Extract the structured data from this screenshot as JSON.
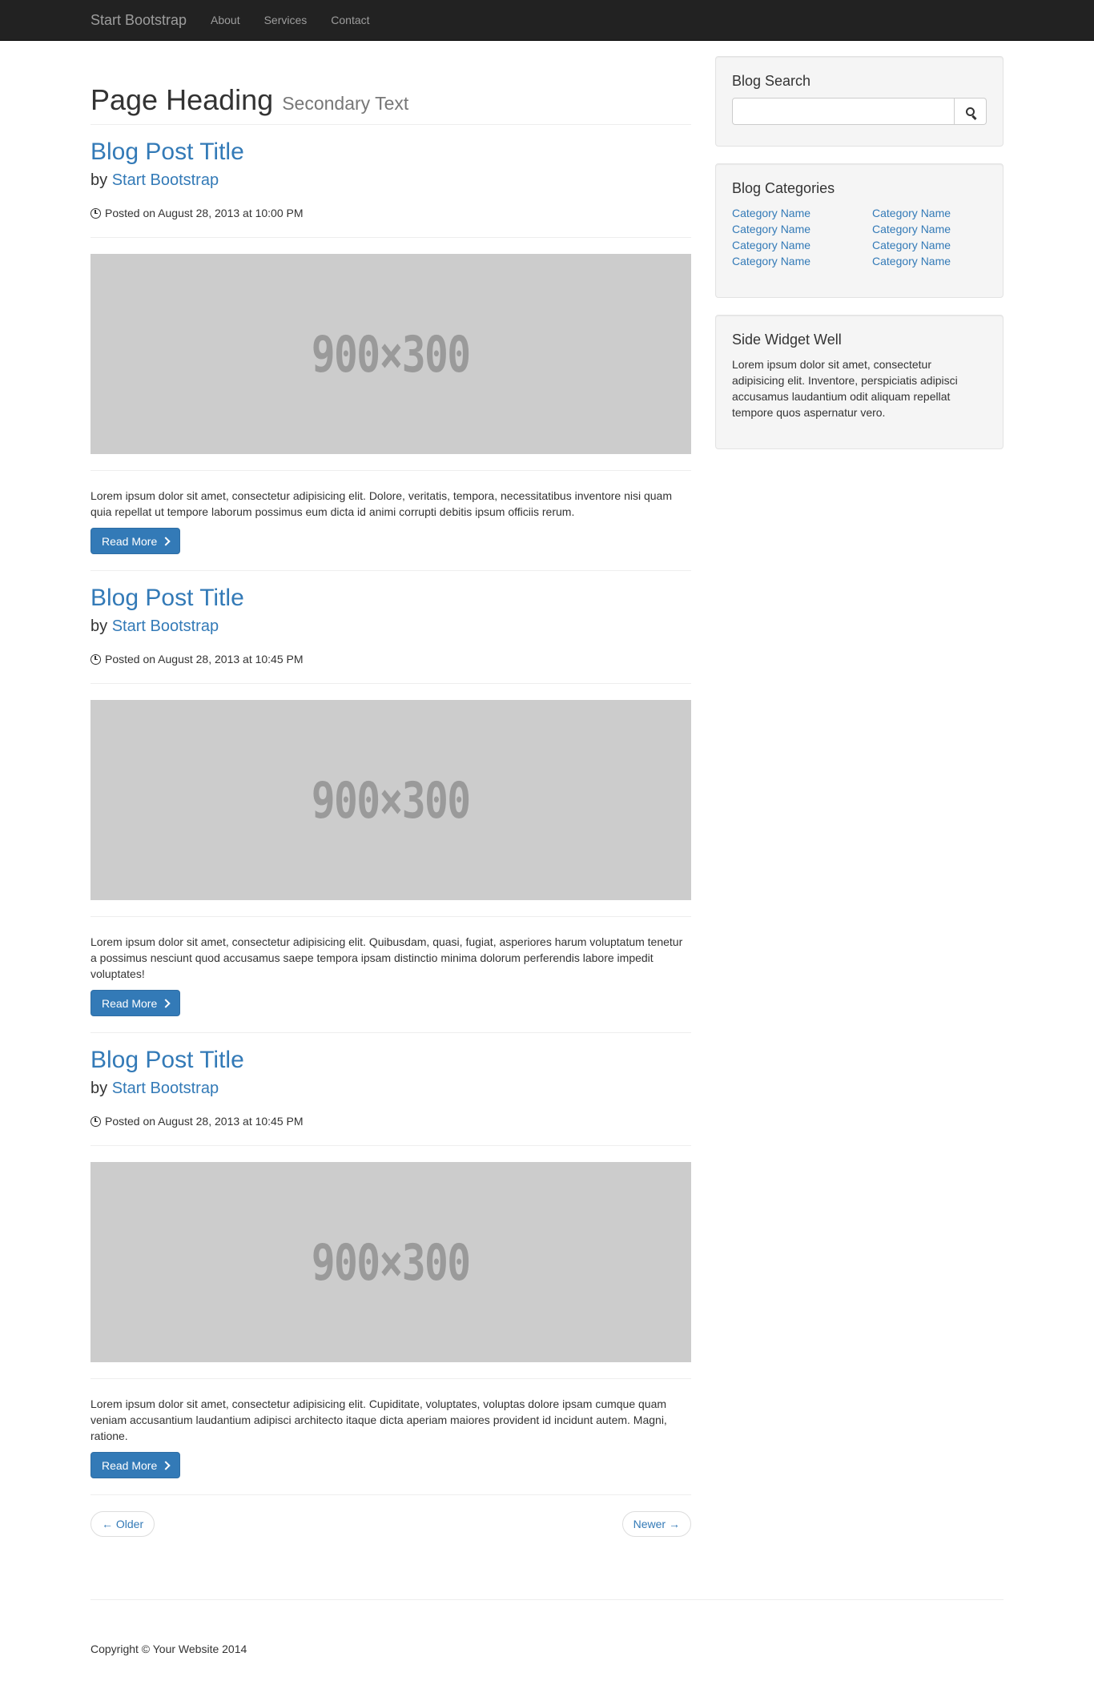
{
  "navbar": {
    "brand": "Start Bootstrap",
    "links": [
      "About",
      "Services",
      "Contact"
    ]
  },
  "header": {
    "heading": "Page Heading",
    "secondary": "Secondary Text"
  },
  "posts": [
    {
      "title": "Blog Post Title",
      "by": "by",
      "author": "Start Bootstrap",
      "date": "Posted on August 28, 2013 at 10:00 PM",
      "image_text": "900×300",
      "text": "Lorem ipsum dolor sit amet, consectetur adipisicing elit. Dolore, veritatis, tempora, necessitatibus inventore nisi quam quia repellat ut tempore laborum possimus eum dicta id animi corrupti debitis ipsum officiis rerum.",
      "read_more": "Read More"
    },
    {
      "title": "Blog Post Title",
      "by": "by",
      "author": "Start Bootstrap",
      "date": "Posted on August 28, 2013 at 10:45 PM",
      "image_text": "900×300",
      "text": "Lorem ipsum dolor sit amet, consectetur adipisicing elit. Quibusdam, quasi, fugiat, asperiores harum voluptatum tenetur a possimus nesciunt quod accusamus saepe tempora ipsam distinctio minima dolorum perferendis labore impedit voluptates!",
      "read_more": "Read More"
    },
    {
      "title": "Blog Post Title",
      "by": "by",
      "author": "Start Bootstrap",
      "date": "Posted on August 28, 2013 at 10:45 PM",
      "image_text": "900×300",
      "text": "Lorem ipsum dolor sit amet, consectetur adipisicing elit. Cupiditate, voluptates, voluptas dolore ipsam cumque quam veniam accusantium laudantium adipisci architecto itaque dicta aperiam maiores provident id incidunt autem. Magni, ratione.",
      "read_more": "Read More"
    }
  ],
  "pager": {
    "older": "← Older",
    "newer": "Newer →"
  },
  "sidebar": {
    "search_title": "Blog Search",
    "search_value": "",
    "categories_title": "Blog Categories",
    "categories": [
      "Category Name",
      "Category Name",
      "Category Name",
      "Category Name",
      "Category Name",
      "Category Name",
      "Category Name",
      "Category Name"
    ],
    "widget_title": "Side Widget Well",
    "widget_text": "Lorem ipsum dolor sit amet, consectetur adipisicing elit. Inventore, perspiciatis adipisci accusamus laudantium odit aliquam repellat tempore quos aspernatur vero."
  },
  "footer": {
    "copyright": "Copyright © Your Website 2014"
  },
  "colors": {
    "navbar_bg": "#222222",
    "link": "#337ab7",
    "button_primary": "#337ab7",
    "placeholder_bg": "#cccccc",
    "well_bg": "#f5f5f5"
  },
  "icons": {
    "post_date": "clock-icon",
    "read_more": "chevron-right-icon",
    "search": "search-icon"
  }
}
